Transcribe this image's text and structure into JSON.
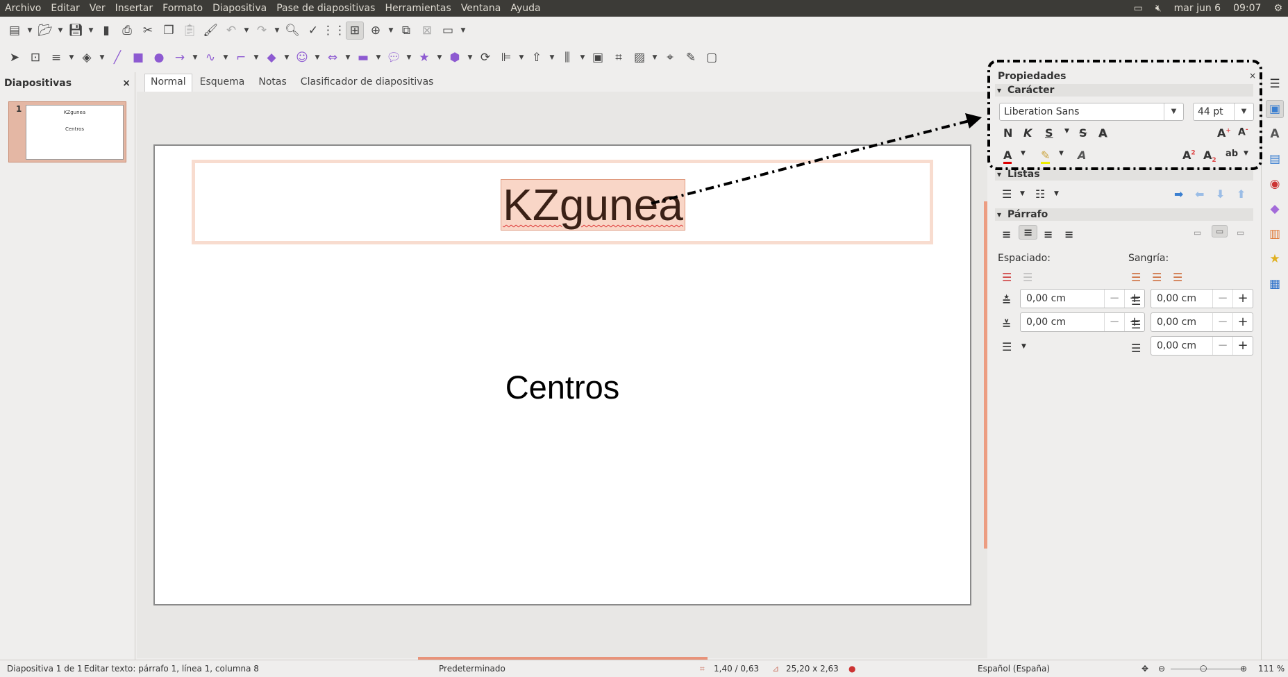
{
  "menu": [
    "Archivo",
    "Editar",
    "Ver",
    "Insertar",
    "Formato",
    "Diapositiva",
    "Pase de diapositivas",
    "Herramientas",
    "Ventana",
    "Ayuda"
  ],
  "tray": {
    "date": "mar jun 6",
    "time": "09:07"
  },
  "toolbar1": [
    "new-icon",
    "open-icon",
    "save-icon",
    "export-pdf-icon",
    "print-icon",
    "cut-icon",
    "copy-icon",
    "paste-icon",
    "clone-format-icon",
    "undo-icon",
    "redo-icon",
    "find-replace-icon",
    "spellcheck-icon",
    "grid-icon",
    "snap-guides-icon",
    "new-slide-icon",
    "duplicate-slide-icon",
    "delete-slide-icon",
    "slide-layout-icon"
  ],
  "toolbar2": [
    "select-icon",
    "zoom-pan-icon",
    "line-color-icon",
    "fill-color-icon",
    "line-icon",
    "rectangle-icon",
    "ellipse-icon",
    "arrow-line-icon",
    "curve-icon",
    "connector-icon",
    "basic-shapes-icon",
    "symbol-shapes-icon",
    "block-arrows-icon",
    "flowchart-icon",
    "callouts-icon",
    "stars-icon",
    "3d-objects-icon",
    "rotate-icon",
    "align-icon",
    "arrange-icon",
    "distribute-icon",
    "shadow-icon",
    "crop-icon",
    "filter-icon",
    "points-icon",
    "glue-points-icon",
    "toggle-extrusion-icon"
  ],
  "slides_panel": {
    "title": "Diapositivas",
    "close": "×",
    "thumb": {
      "number": "1",
      "title": "KZgunea",
      "subtitle": "Centros"
    }
  },
  "view_tabs": [
    "Normal",
    "Esquema",
    "Notas",
    "Clasificador de diapositivas"
  ],
  "slide": {
    "title": "KZgunea",
    "subtitle": "Centros"
  },
  "properties": {
    "title": "Propiedades",
    "close": "×",
    "character": {
      "header": "Carácter",
      "font": "Liberation Sans",
      "size": "44 pt",
      "bold": "N",
      "italic": "K",
      "underline": "S",
      "strike": "S",
      "shadow": "A"
    },
    "lists": {
      "header": "Listas"
    },
    "paragraph": {
      "header": "Párrafo",
      "spacing_label": "Espaciado:",
      "indent_label": "Sangría:",
      "above": "0,00 cm",
      "below": "0,00 cm",
      "before_indent": "0,00 cm",
      "after_indent": "0,00 cm",
      "first_line": "0,00 cm",
      "minus": "−",
      "plus": "+"
    }
  },
  "statusbar": {
    "slide": "Diapositiva 1 de 1",
    "edit": "Editar texto: párrafo 1, línea 1, columna 8",
    "layout": "Predeterminado",
    "position": "1,40 / 0,63",
    "size": "25,20 x 2,63",
    "language": "Español (España)",
    "zoom": "111 %"
  },
  "colors": {
    "accent": "#e8937a",
    "selection": "#f9d6c7",
    "menubar": "#3c3b37"
  }
}
